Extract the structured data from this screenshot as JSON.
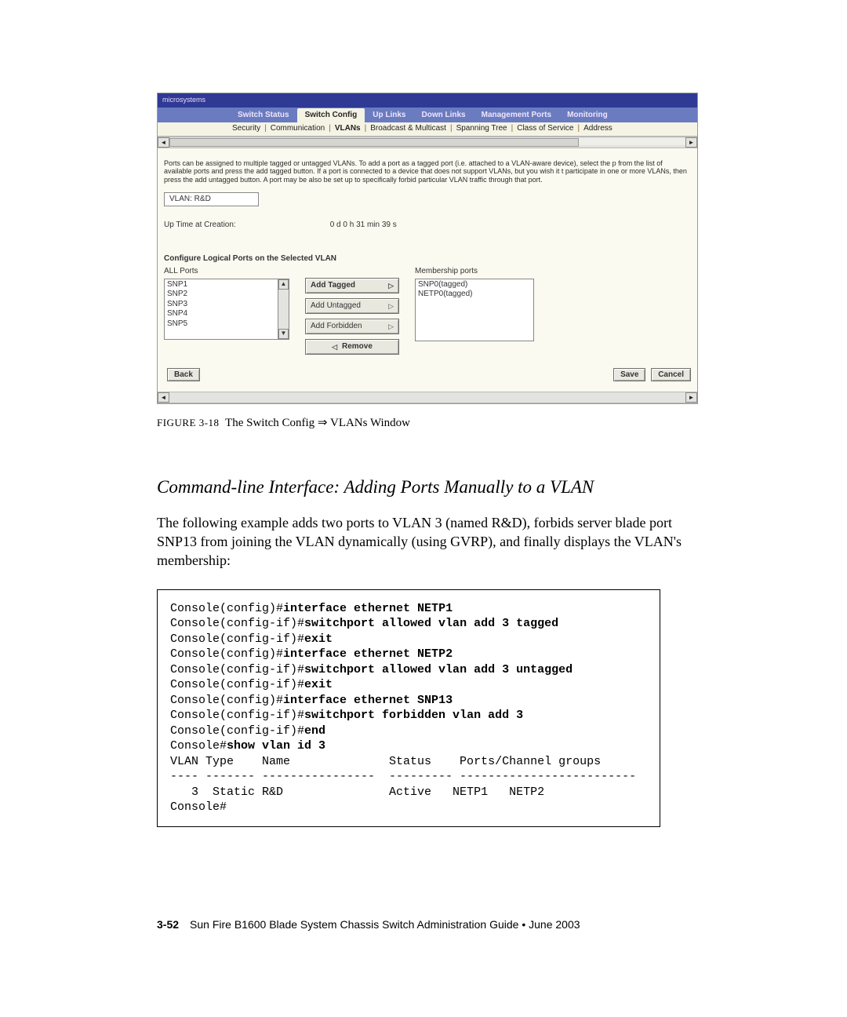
{
  "figure": {
    "titlebar": "microsystems",
    "primary_tabs": [
      "Switch Status",
      "Switch Config",
      "Up Links",
      "Down Links",
      "Management Ports",
      "Monitoring"
    ],
    "active_primary": "Switch Config",
    "secondary_tabs": [
      "Security",
      "Communication",
      "VLANs",
      "Broadcast & Multicast",
      "Spanning Tree",
      "Class of Service",
      "Address"
    ],
    "active_secondary": "VLANs",
    "description": "Ports can be assigned to multiple tagged or untagged VLANs. To add a port as a tagged port (i.e. attached to a VLAN-aware device), select the p from the list of available ports and press the add tagged button. If a port is connected to a device that does not support VLANs, but you wish it t participate in one or more VLANs, then press the add untagged button. A port may be also be set up to specifically forbid particular VLAN traffic through that port.",
    "vlan_box": "VLAN: R&D",
    "uptime_label": "Up Time at Creation:",
    "uptime_value": "0 d 0 h 31 min 39 s",
    "section": "Configure Logical Ports on the Selected VLAN",
    "all_ports_label": "ALL Ports",
    "all_ports": [
      "SNP1",
      "SNP2",
      "SNP3",
      "SNP4",
      "SNP5"
    ],
    "btn_add_tagged": "Add Tagged",
    "btn_add_untagged": "Add Untagged",
    "btn_add_forbidden": "Add Forbidden",
    "btn_remove": "Remove",
    "membership_label": "Membership ports",
    "membership_ports": [
      "SNP0(tagged)",
      "NETP0(tagged)"
    ],
    "btn_back": "Back",
    "btn_save": "Save",
    "btn_cancel": "Cancel"
  },
  "caption_label": "FIGURE 3-18",
  "caption_text": "The Switch Config ⇒ VLANs Window",
  "section_heading": "Command-line Interface: Adding Ports Manually to a VLAN",
  "body_para": "The following example adds two ports to VLAN 3 (named R&D), forbids server blade port SNP13 from joining the VLAN dynamically (using GVRP), and finally displays the VLAN's membership:",
  "cli": {
    "l1p": "Console(config)#",
    "l1b": "interface ethernet NETP1",
    "l2p": "Console(config-if)#",
    "l2b": "switchport allowed vlan add 3 tagged",
    "l3p": "Console(config-if)#",
    "l3b": "exit",
    "l4p": "Console(config)#",
    "l4b": "interface ethernet NETP2",
    "l5p": "Console(config-if)#",
    "l5b": "switchport allowed vlan add 3 untagged",
    "l6p": "Console(config-if)#",
    "l6b": "exit",
    "l7p": "Console(config)#",
    "l7b": "interface ethernet SNP13",
    "l8p": "Console(config-if)#",
    "l8b": "switchport forbidden vlan add 3",
    "l9p": "Console(config-if)#",
    "l9b": "end",
    "l10p": "Console#",
    "l10b": "show vlan id 3",
    "l11": "VLAN Type    Name              Status    Ports/Channel groups",
    "l12": "---- ------- ----------------  --------- -------------------------",
    "l13": "   3  Static R&D               Active   NETP1   NETP2",
    "l14": "Console#"
  },
  "footer_page": "3-52",
  "footer_text": "Sun Fire B1600 Blade System Chassis Switch Administration Guide • June 2003"
}
